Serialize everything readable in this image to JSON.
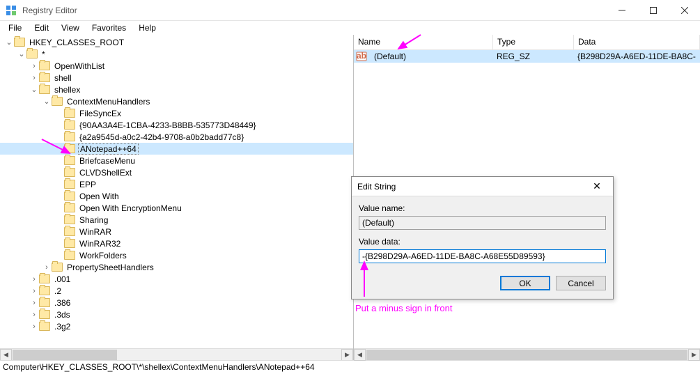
{
  "window": {
    "title": "Registry Editor"
  },
  "menu": {
    "items": [
      "File",
      "Edit",
      "View",
      "Favorites",
      "Help"
    ]
  },
  "tree": {
    "root": "HKEY_CLASSES_ROOT",
    "star": "*",
    "children_top": [
      "OpenWithList",
      "shell",
      "shellex"
    ],
    "shellex_child": "ContextMenuHandlers",
    "handlers": [
      "FileSyncEx",
      "{90AA3A4E-1CBA-4233-B8BB-535773D48449}",
      "{a2a9545d-a0c2-42b4-9708-a0b2badd77c8}",
      "ANotepad++64",
      "BriefcaseMenu",
      "CLVDShellExt",
      "EPP",
      "Open With",
      "Open With EncryptionMenu",
      "Sharing",
      "WinRAR",
      "WinRAR32",
      "WorkFolders"
    ],
    "after_handlers": "PropertySheetHandlers",
    "siblings": [
      ".001",
      ".2",
      ".386",
      ".3ds",
      ".3g2"
    ]
  },
  "list": {
    "headers": {
      "name": "Name",
      "type": "Type",
      "data": "Data"
    },
    "row": {
      "name": "(Default)",
      "type": "REG_SZ",
      "data": "{B298D29A-A6ED-11DE-BA8C-"
    }
  },
  "dialog": {
    "title": "Edit String",
    "value_name_label": "Value name:",
    "value_name": "(Default)",
    "value_data_label": "Value data:",
    "value_data": "-{B298D29A-A6ED-11DE-BA8C-A68E55D89593}",
    "ok": "OK",
    "cancel": "Cancel"
  },
  "annotation": {
    "text": "Put a minus sign in front"
  },
  "status": {
    "path": "Computer\\HKEY_CLASSES_ROOT\\*\\shellex\\ContextMenuHandlers\\ANotepad++64"
  }
}
